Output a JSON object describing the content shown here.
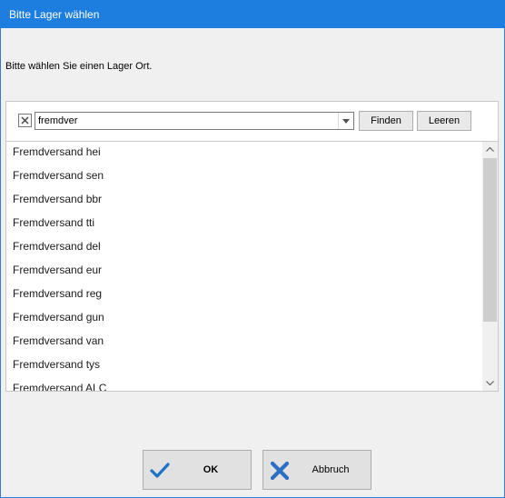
{
  "window": {
    "title": "Bitte Lager wählen"
  },
  "prompt": "Bitte wählen Sie einen Lager Ort.",
  "search": {
    "value": "fremdver",
    "find_label": "Finden",
    "clear_label": "Leeren"
  },
  "list": {
    "items": [
      "Fremdversand hei",
      "Fremdversand sen",
      "Fremdversand bbr",
      "Fremdversand tti",
      "Fremdversand del",
      "Fremdversand eur",
      "Fremdversand reg",
      "Fremdversand gun",
      "Fremdversand van",
      "Fremdversand tys",
      "Fremdversand ALC"
    ]
  },
  "buttons": {
    "ok_label": "OK",
    "cancel_label": "Abbruch"
  },
  "colors": {
    "titlebar": "#1e7ee0",
    "ok_check": "#1e73c8",
    "cancel_x": "#2b6fc4"
  }
}
